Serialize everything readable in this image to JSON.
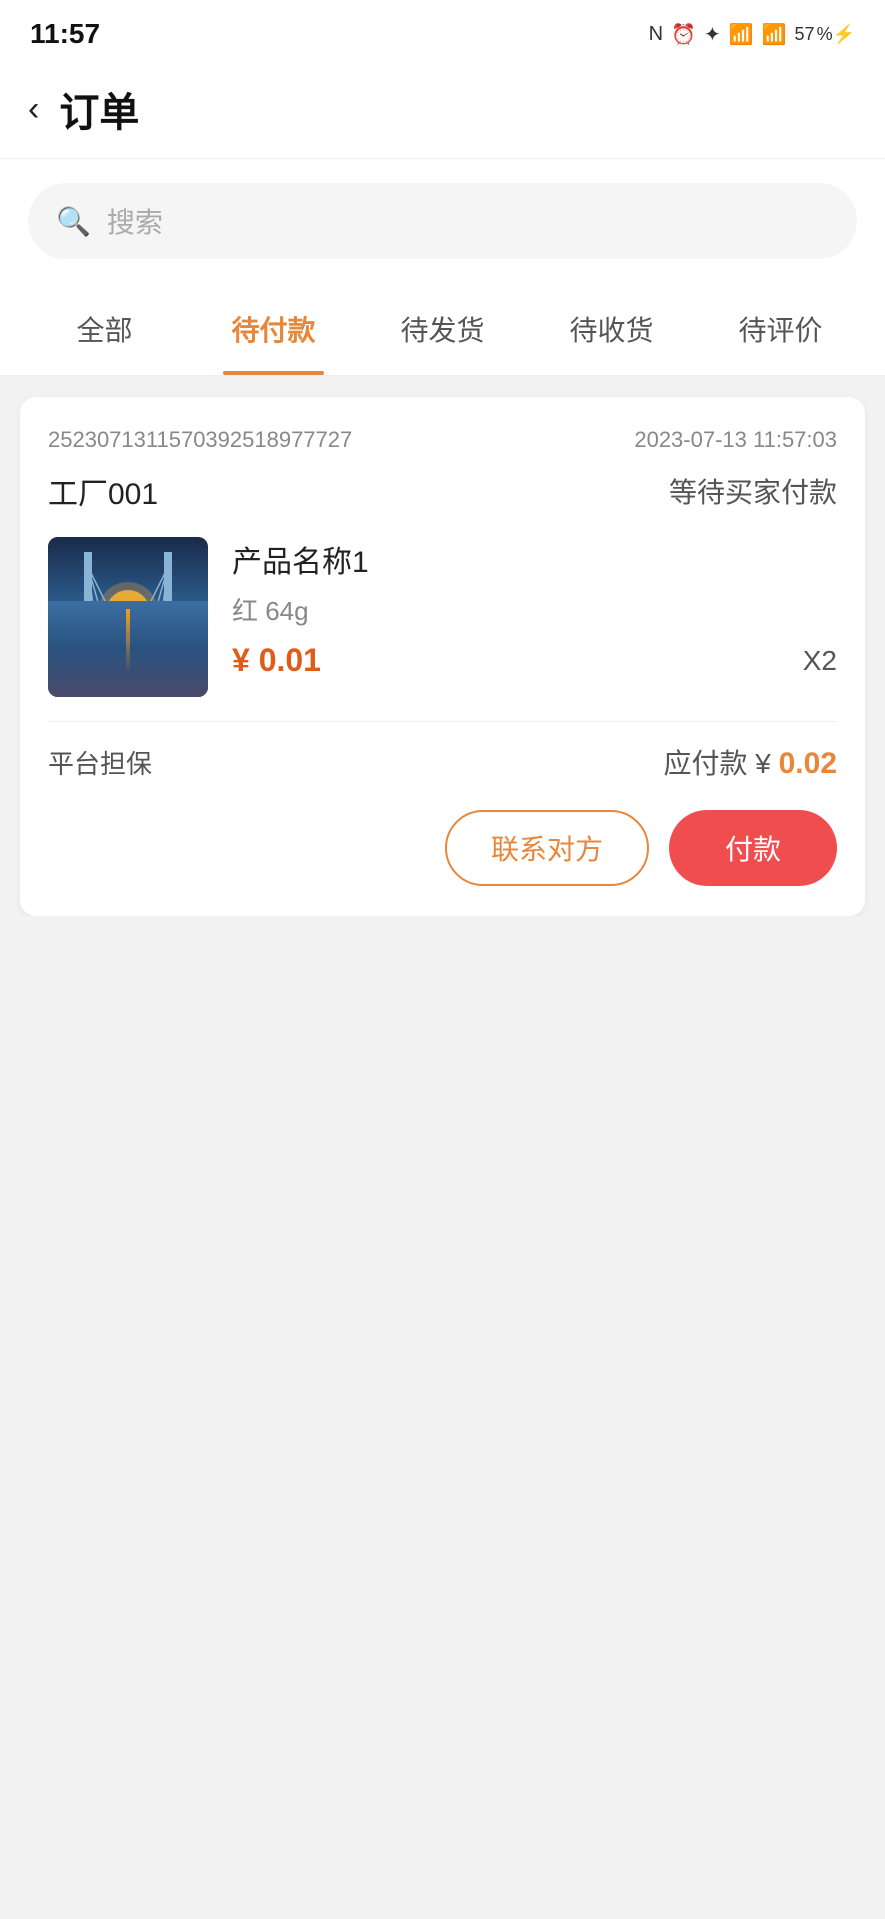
{
  "statusBar": {
    "time": "11:57",
    "battery": "57"
  },
  "header": {
    "back_label": "‹",
    "title": "订单"
  },
  "search": {
    "placeholder": "搜索"
  },
  "tabs": [
    {
      "id": "all",
      "label": "全部",
      "active": false
    },
    {
      "id": "pending_payment",
      "label": "待付款",
      "active": true
    },
    {
      "id": "pending_shipment",
      "label": "待发货",
      "active": false
    },
    {
      "id": "pending_receipt",
      "label": "待收货",
      "active": false
    },
    {
      "id": "pending_review",
      "label": "待评价",
      "active": false
    }
  ],
  "order": {
    "id": "2523071311570392518977727",
    "date": "2023-07-13 11:57:03",
    "seller": "工厂001",
    "status": "等待买家付款",
    "product": {
      "name": "产品名称1",
      "spec": "红   64g",
      "price": "¥ 0.01",
      "quantity": "X2"
    },
    "platform_guarantee": "平台担保",
    "amount_label": "应付款 ¥",
    "amount_value": "0.02",
    "btn_contact": "联系对方",
    "btn_pay": "付款"
  }
}
